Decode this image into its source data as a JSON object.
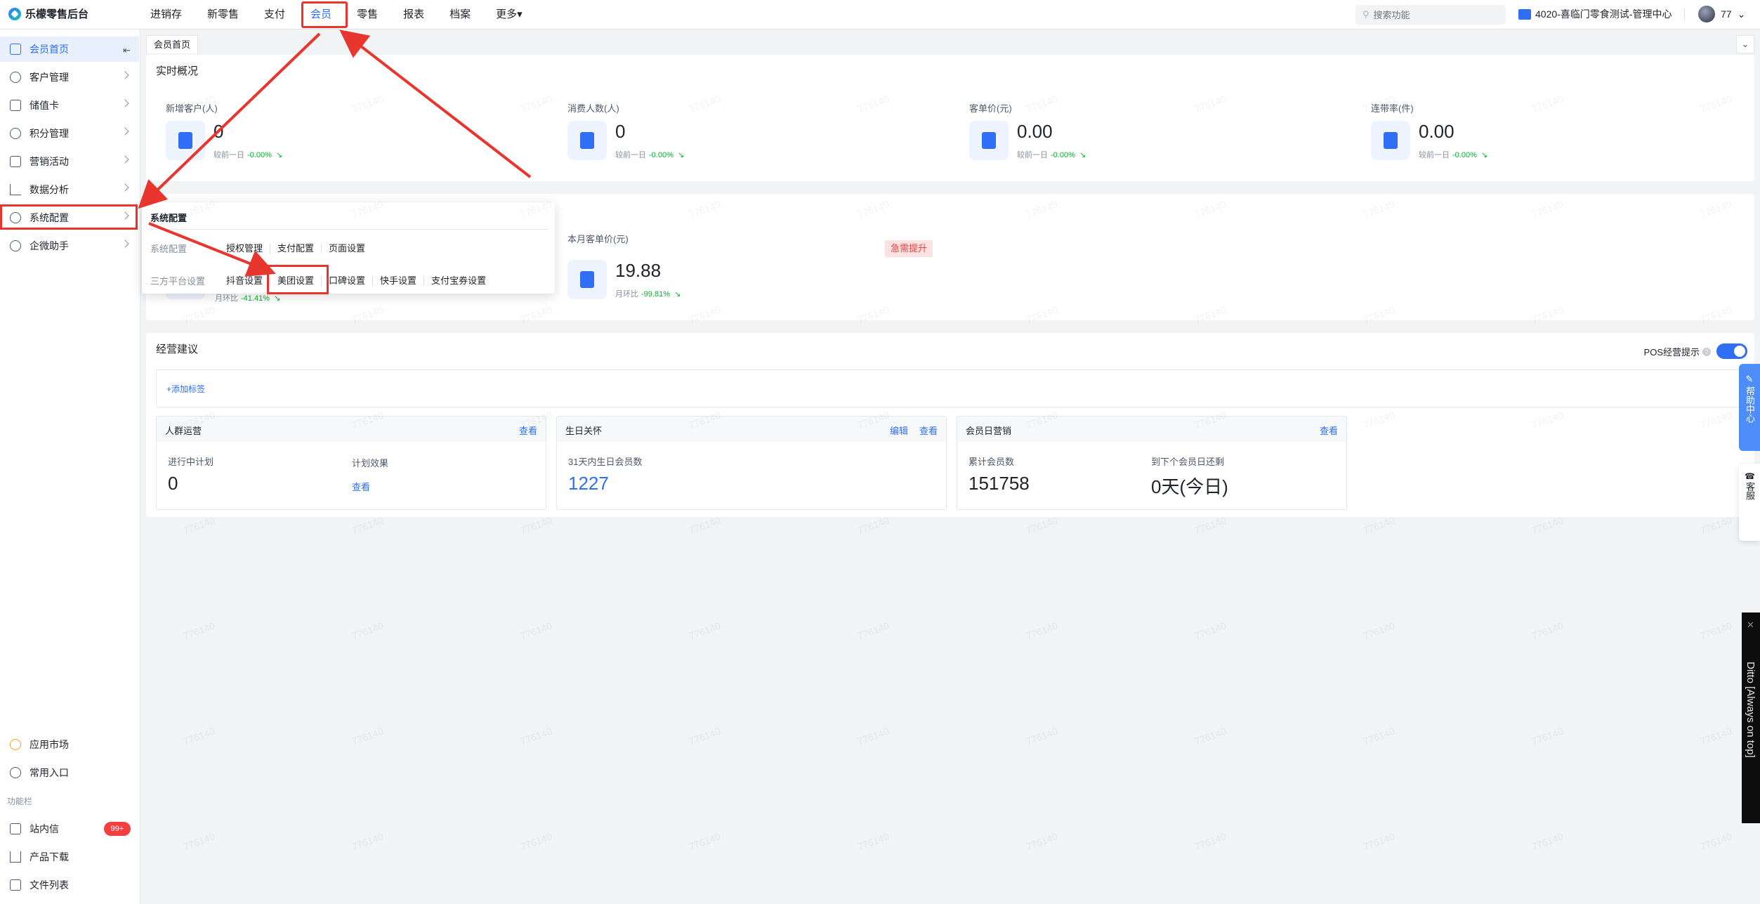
{
  "app": {
    "name": "乐檬零售后台"
  },
  "nav": [
    {
      "label": "进销存"
    },
    {
      "label": "新零售"
    },
    {
      "label": "支付"
    },
    {
      "label": "会员"
    },
    {
      "label": "零售"
    },
    {
      "label": "报表"
    },
    {
      "label": "档案"
    },
    {
      "label": "更多▾"
    }
  ],
  "search": {
    "placeholder": "搜索功能",
    "value": ""
  },
  "store": "4020-喜临门零食测试-管理中心",
  "user": {
    "name": "77"
  },
  "sidebar": {
    "items": [
      {
        "label": "会员首页"
      },
      {
        "label": "客户管理"
      },
      {
        "label": "储值卡"
      },
      {
        "label": "积分管理"
      },
      {
        "label": "营销活动"
      },
      {
        "label": "数据分析"
      },
      {
        "label": "系统配置"
      },
      {
        "label": "企微助手"
      }
    ],
    "bottom": [
      {
        "label": "应用市场"
      },
      {
        "label": "常用入口"
      }
    ],
    "section": "功能栏",
    "func": [
      {
        "label": "站内信"
      },
      {
        "label": "产品下载"
      },
      {
        "label": "文件列表"
      }
    ],
    "badge": "99+"
  },
  "tab": {
    "label": "会员首页"
  },
  "realtime": {
    "title": "实时概况",
    "metrics": [
      {
        "label": "新增客户(人)",
        "value": "0",
        "compare": "较前一日",
        "pct": "-0.00%"
      },
      {
        "label": "消费人数(人)",
        "value": "0",
        "compare": "较前一日",
        "pct": "-0.00%"
      },
      {
        "label": "客单价(元)",
        "value": "0.00",
        "compare": "较前一日",
        "pct": "-0.00%"
      },
      {
        "label": "连带率(件)",
        "value": "0.00",
        "compare": "较前一日",
        "pct": "-0.00%"
      }
    ]
  },
  "monthly": {
    "left_compare": "月环比",
    "left_pct": "-41.41%",
    "avg_label": "本月客单价(元)",
    "avg_value": "19.88",
    "avg_compare": "月环比",
    "avg_pct": "-99.81%",
    "urgent": "急需提升"
  },
  "popup": {
    "title": "系统配置",
    "row1_label": "系统配置",
    "row1": [
      "授权管理",
      "支付配置",
      "页面设置"
    ],
    "row2_label": "三方平台设置",
    "row2": [
      "抖音设置",
      "美团设置",
      "口碑设置",
      "快手设置",
      "支付宝券设置"
    ]
  },
  "advice": {
    "title": "经营建议",
    "pos_label": "POS经营提示",
    "add_tag": "+添加标签",
    "cards": [
      {
        "title": "人群运营",
        "links": [
          "查看"
        ],
        "l1": "进行中计划",
        "v1": "0",
        "l2": "计划效果",
        "v2": "查看"
      },
      {
        "title": "生日关怀",
        "links": [
          "编辑",
          "查看"
        ],
        "l1": "31天内生日会员数",
        "v1": "1227"
      },
      {
        "title": "会员日营销",
        "links": [
          "查看"
        ],
        "l1": "累计会员数",
        "v1": "151758",
        "l2": "到下个会员日还剩",
        "v2": "0天(今日)"
      }
    ]
  },
  "float": {
    "help": "帮助中心",
    "kefu": "客服",
    "ditto": "Ditto [Always on top]"
  },
  "watermark": "776140",
  "colors": {
    "accent": "#2f6ef5",
    "highlight": "#e8352e",
    "up": "#00b42a"
  }
}
